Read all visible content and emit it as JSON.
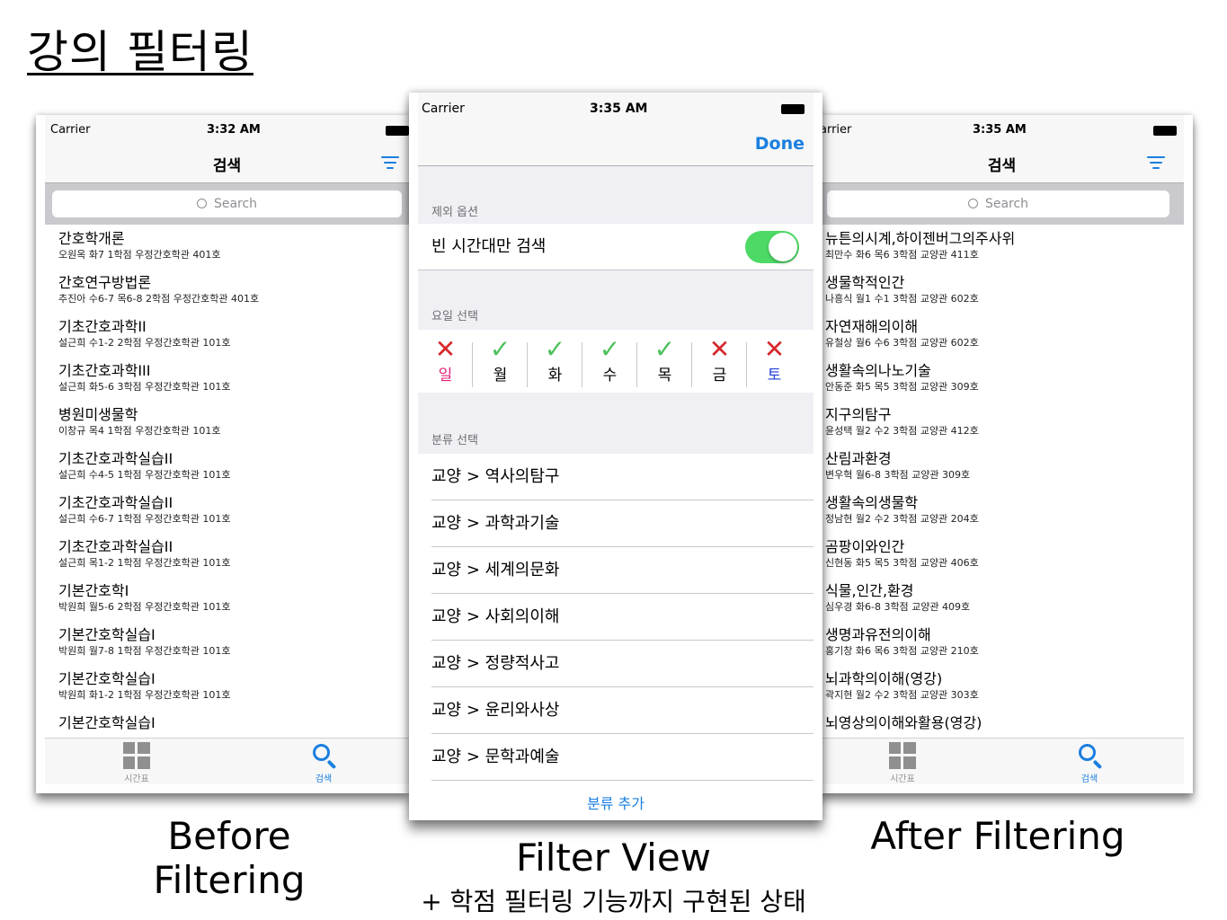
{
  "page_title": "강의 필터링",
  "captions": {
    "before": "Before Filtering",
    "filter_view": "Filter View",
    "after": "After Filtering",
    "filter_sub": "+ 학점 필터링 기능까지 구현된 상태"
  },
  "before": {
    "status": {
      "carrier": "Carrier",
      "time": "3:32 AM"
    },
    "nav_title": "검색",
    "search_placeholder": "Search",
    "rows": [
      {
        "name": "간호학개론",
        "meta": "오원옥  화7  1학점  우정간호학관 401호"
      },
      {
        "name": "간호연구방법론",
        "meta": "추진아  수6-7 목6-8  2학점  우정간호학관 401호"
      },
      {
        "name": "기초간호과학II",
        "meta": "설근희  수1-2  2학점  우정간호학관 101호"
      },
      {
        "name": "기초간호과학III",
        "meta": "설근희  화5-6  3학점  우정간호학관 101호"
      },
      {
        "name": "병원미생물학",
        "meta": "이창규  목4  1학점  우정간호학관 101호"
      },
      {
        "name": "기초간호과학실습II",
        "meta": "설근희  수4-5  1학점  우정간호학관 101호"
      },
      {
        "name": "기초간호과학실습II",
        "meta": "설근희  수6-7  1학점  우정간호학관 101호"
      },
      {
        "name": "기초간호과학실습II",
        "meta": "설근희  목1-2  1학점  우정간호학관 101호"
      },
      {
        "name": "기본간호학I",
        "meta": "박원희  월5-6  2학점  우정간호학관 101호"
      },
      {
        "name": "기본간호학실습I",
        "meta": "박원희  월7-8  1학점  우정간호학관 101호"
      },
      {
        "name": "기본간호학실습I",
        "meta": "박원희  화1-2  1학점  우정간호학관 101호"
      },
      {
        "name": "기본간호학실습I",
        "meta": ""
      }
    ],
    "tabs": {
      "timetable": "시간표",
      "search": "검색"
    }
  },
  "filter": {
    "status": {
      "carrier": "Carrier",
      "time": "3:35 AM"
    },
    "done_label": "Done",
    "exclude_header": "제외 옵션",
    "empty_only_label": "빈 시간대만 검색",
    "empty_only_on": true,
    "day_header": "요일 선택",
    "days": [
      {
        "label": "일",
        "selected": false,
        "color": "#e0207a"
      },
      {
        "label": "월",
        "selected": true,
        "color": "#000000"
      },
      {
        "label": "화",
        "selected": true,
        "color": "#000000"
      },
      {
        "label": "수",
        "selected": true,
        "color": "#000000"
      },
      {
        "label": "목",
        "selected": true,
        "color": "#000000"
      },
      {
        "label": "금",
        "selected": false,
        "color": "#000000"
      },
      {
        "label": "토",
        "selected": false,
        "color": "#1f3fd6"
      }
    ],
    "category_header": "분류 선택",
    "categories": [
      "교양 > 역사의탐구",
      "교양 > 과학과기술",
      "교양 > 세계의문화",
      "교양 > 사회의이해",
      "교양 > 정량적사고",
      "교양 > 윤리와사상",
      "교양 > 문학과예술"
    ],
    "add_label": "분류 추가"
  },
  "after": {
    "status": {
      "carrier": "arrier",
      "time": "3:35 AM"
    },
    "nav_title": "검색",
    "search_placeholder": "Search",
    "rows": [
      {
        "name": "뉴튼의시계,하이젠버그의주사위",
        "meta": "최만수  화6 목6  3학점  교양관 411호"
      },
      {
        "name": "생물학적인간",
        "meta": "나흥식  월1 수1  3학점  교양관 602호"
      },
      {
        "name": "자연재해의이해",
        "meta": "유철상  월6 수6  3학점  교양관 602호"
      },
      {
        "name": "생활속의나노기술",
        "meta": "안동준  화5 목5  3학점  교양관 309호"
      },
      {
        "name": "지구의탐구",
        "meta": "윤성택  월2 수2  3학점  교양관 412호"
      },
      {
        "name": "산림과환경",
        "meta": "변우혁  월6-8  3학점  교양관 309호"
      },
      {
        "name": "생활속의생물학",
        "meta": "정남현  월2 수2  3학점  교양관 204호"
      },
      {
        "name": "곰팡이와인간",
        "meta": "신현동  화5 목5  3학점  교양관 406호"
      },
      {
        "name": "식물,인간,환경",
        "meta": "심우경  화6-8  3학점  교양관 409호"
      },
      {
        "name": "생명과유전의이해",
        "meta": "홍기창  화6 목6  3학점  교양관 210호"
      },
      {
        "name": "뇌과학의이해(영강)",
        "meta": "곽지현  월2 수2  3학점  교양관 303호"
      },
      {
        "name": "뇌영상의이해와활용(영강)",
        "meta": ""
      }
    ],
    "tabs": {
      "timetable": "시간표",
      "search": "검색"
    }
  }
}
